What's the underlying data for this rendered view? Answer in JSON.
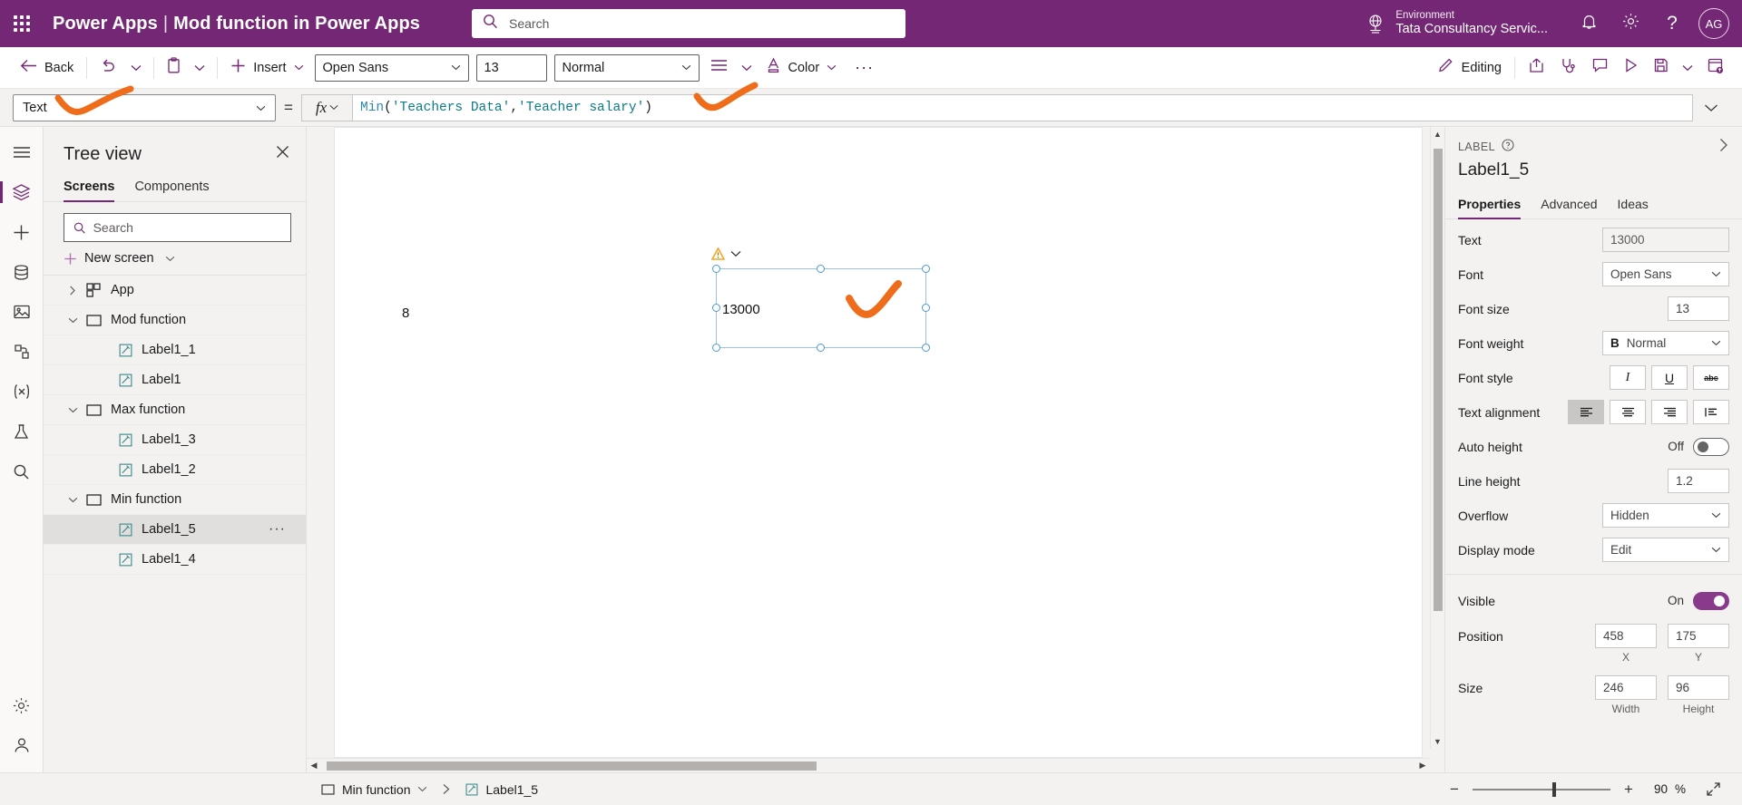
{
  "topbar": {
    "waffle_title": "App launcher",
    "brand": "Power Apps",
    "separator": "|",
    "app_title": "Mod function in Power Apps",
    "search_placeholder": "Search",
    "environment_label": "Environment",
    "environment_name": "Tata Consultancy Servic...",
    "avatar_initials": "AG"
  },
  "commandbar": {
    "back": "Back",
    "insert": "Insert",
    "font": "Open Sans",
    "font_size": "13",
    "font_weight": "Normal",
    "color": "Color",
    "ellipsis": "···",
    "editing": "Editing"
  },
  "formula": {
    "property": "Text",
    "equals": "=",
    "fx": "fx",
    "tokens": [
      {
        "t": "Min",
        "k": "fn"
      },
      {
        "t": "(",
        "k": "punc"
      },
      {
        "t": "'Teachers Data'",
        "k": "str"
      },
      {
        "t": ", ",
        "k": "punc"
      },
      {
        "t": "'Teacher salary'",
        "k": "str"
      },
      {
        "t": ")",
        "k": "punc"
      }
    ]
  },
  "treeview": {
    "title": "Tree view",
    "tabs": [
      {
        "label": "Screens",
        "active": true
      },
      {
        "label": "Components",
        "active": false
      }
    ],
    "search_placeholder": "Search",
    "new_screen": "New screen",
    "items": [
      {
        "label": "App",
        "type": "app",
        "level": 0,
        "chev": "right",
        "selected": false
      },
      {
        "label": "Mod function",
        "type": "screen",
        "level": 0,
        "chev": "down",
        "selected": false
      },
      {
        "label": "Label1_1",
        "type": "label",
        "level": 1,
        "chev": "",
        "selected": false
      },
      {
        "label": "Label1",
        "type": "label",
        "level": 1,
        "chev": "",
        "selected": false
      },
      {
        "label": "Max function",
        "type": "screen",
        "level": 0,
        "chev": "down",
        "selected": false
      },
      {
        "label": "Label1_3",
        "type": "label",
        "level": 1,
        "chev": "",
        "selected": false
      },
      {
        "label": "Label1_2",
        "type": "label",
        "level": 1,
        "chev": "",
        "selected": false
      },
      {
        "label": "Min function",
        "type": "screen",
        "level": 0,
        "chev": "down",
        "selected": false
      },
      {
        "label": "Label1_5",
        "type": "label",
        "level": 1,
        "chev": "",
        "selected": true,
        "more": "···"
      },
      {
        "label": "Label1_4",
        "type": "label",
        "level": 1,
        "chev": "",
        "selected": false
      }
    ]
  },
  "canvas": {
    "left_value": "8",
    "selected_label_text": "13000"
  },
  "properties": {
    "kicker": "LABEL",
    "name": "Label1_5",
    "tabs": [
      {
        "label": "Properties",
        "active": true
      },
      {
        "label": "Advanced",
        "active": false
      },
      {
        "label": "Ideas",
        "active": false
      }
    ],
    "text_label": "Text",
    "text_value": "13000",
    "font_label": "Font",
    "font_value": "Open Sans",
    "font_size_label": "Font size",
    "font_size_value": "13",
    "font_weight_label": "Font weight",
    "font_weight_bold_glyph": "B",
    "font_weight_value": "Normal",
    "font_style_label": "Font style",
    "font_style_italic": "I",
    "font_style_underline": "U",
    "font_style_strike": "abc",
    "text_alignment_label": "Text alignment",
    "auto_height_label": "Auto height",
    "auto_height_state": "Off",
    "line_height_label": "Line height",
    "line_height_value": "1.2",
    "overflow_label": "Overflow",
    "overflow_value": "Hidden",
    "display_mode_label": "Display mode",
    "display_mode_value": "Edit",
    "visible_label": "Visible",
    "visible_state": "On",
    "position_label": "Position",
    "position_x": "458",
    "position_y": "175",
    "position_x_caption": "X",
    "position_y_caption": "Y",
    "size_label": "Size",
    "size_width": "246",
    "size_height": "96",
    "size_width_caption": "Width",
    "size_height_caption": "Height"
  },
  "bottombar": {
    "screen_crumb": "Min function",
    "control_crumb": "Label1_5",
    "zoom_value": "90",
    "zoom_unit": "%"
  },
  "colors": {
    "brand_purple": "#742774",
    "accent_purple": "#8a3a8a",
    "annotation_orange": "#ef6c1a",
    "selection_blue": "#4a9ad4"
  }
}
